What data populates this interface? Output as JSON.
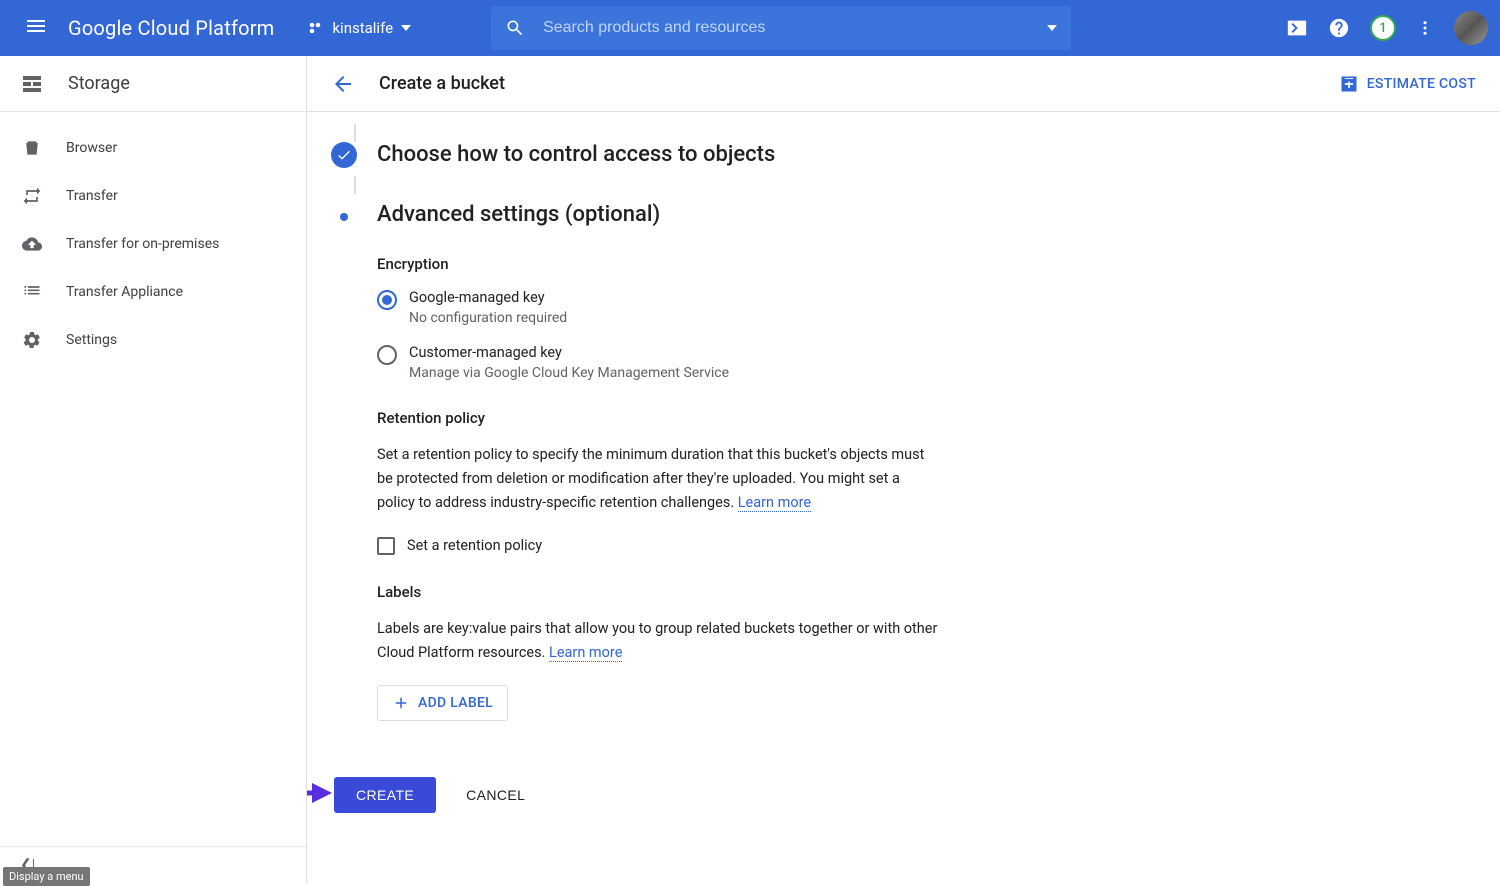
{
  "header": {
    "logo": "Google Cloud Platform",
    "project": "kinstalife",
    "search_placeholder": "Search products and resources",
    "notification_count": "1"
  },
  "sidebar": {
    "title": "Storage",
    "items": [
      {
        "label": "Browser"
      },
      {
        "label": "Transfer"
      },
      {
        "label": "Transfer for on-premises"
      },
      {
        "label": "Transfer Appliance"
      },
      {
        "label": "Settings"
      }
    ],
    "tooltip": "Display a menu"
  },
  "page": {
    "title": "Create a bucket",
    "estimate_cost": "ESTIMATE COST",
    "step_completed": "Choose how to control access to objects",
    "step_current": "Advanced settings (optional)",
    "encryption": {
      "heading": "Encryption",
      "option1_label": "Google-managed key",
      "option1_helper": "No configuration required",
      "option2_label": "Customer-managed key",
      "option2_helper": "Manage via Google Cloud Key Management Service"
    },
    "retention": {
      "heading": "Retention policy",
      "desc": "Set a retention policy to specify the minimum duration that this bucket's objects must be protected from deletion or modification after they're uploaded. You might set a policy to address industry-specific retention challenges. ",
      "learn_more": "Learn more",
      "checkbox_label": "Set a retention policy"
    },
    "labels": {
      "heading": "Labels",
      "desc": "Labels are key:value pairs that allow you to group related buckets together or with other Cloud Platform resources. ",
      "learn_more": "Learn more",
      "add_button": "ADD LABEL"
    },
    "create_button": "CREATE",
    "cancel_button": "CANCEL"
  }
}
